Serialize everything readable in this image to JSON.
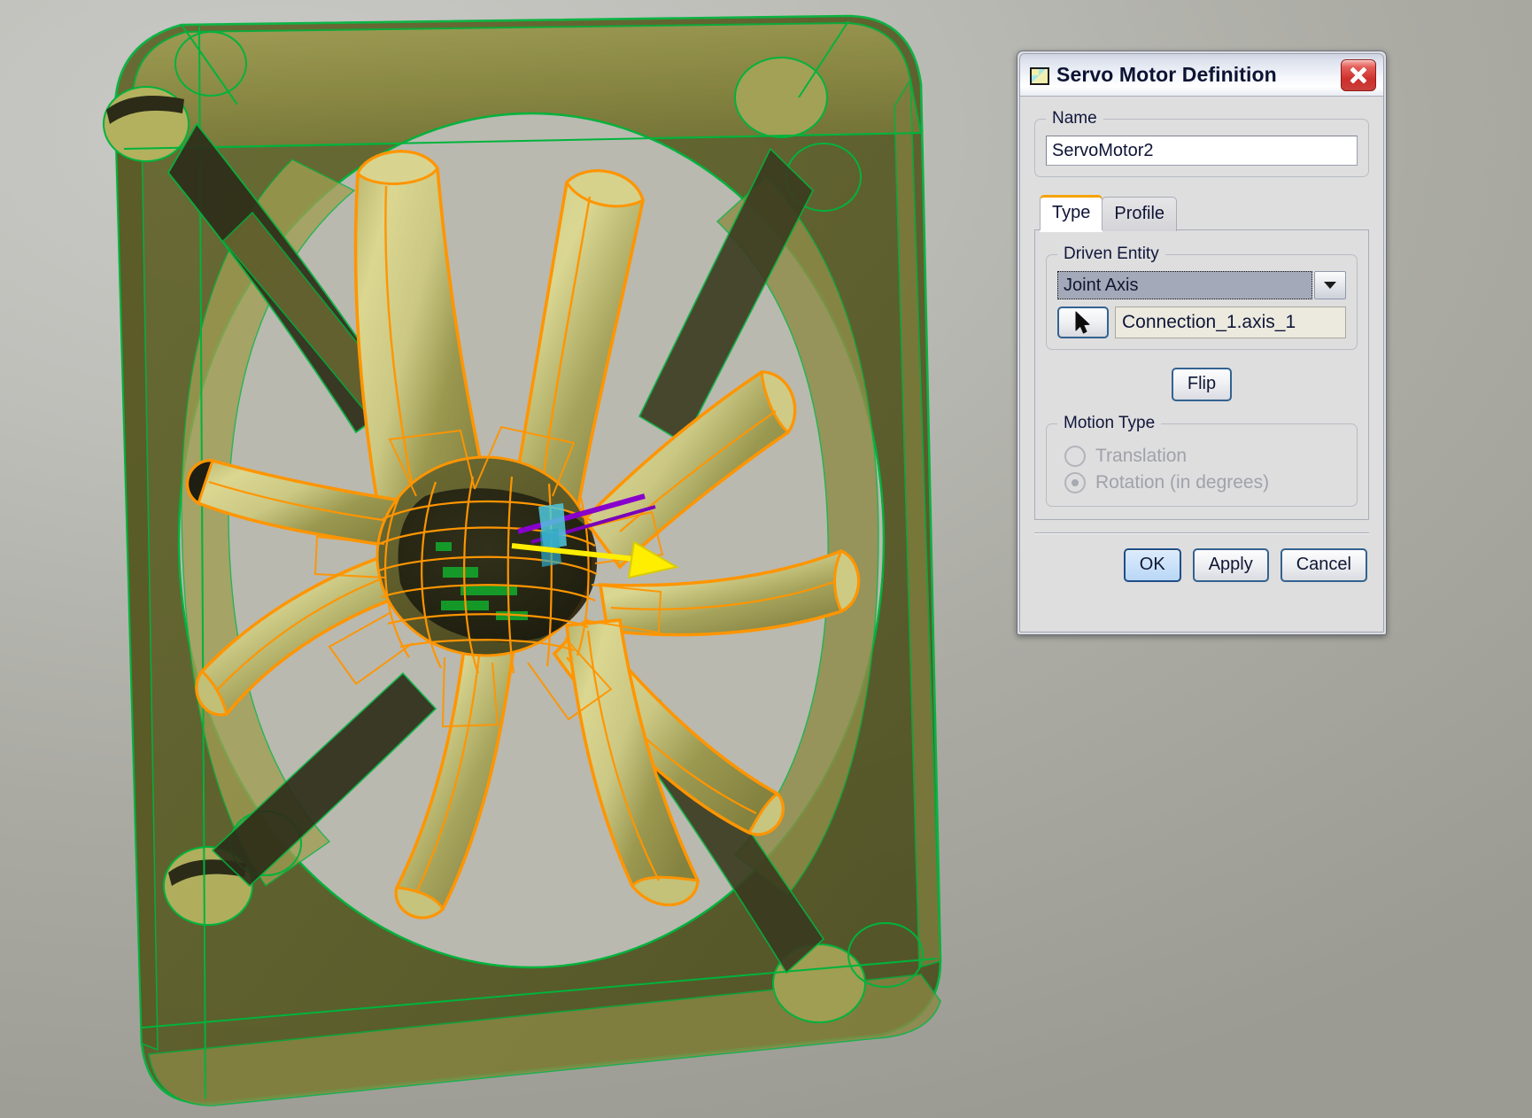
{
  "viewport": {
    "name": "cad-3d-viewport",
    "model_description": "Axial cooling fan assembly shown in shaded-with-edges mode; fan blades highlighted in orange (selected), housing frame edges in green, joint axis manipulator drawn at the hub",
    "colors": {
      "background_top": "#c9c9c6",
      "background_bottom": "#9b9b93",
      "frame_surface": "#5d5f28",
      "frame_surface_light": "#9c9a4f",
      "blade_surface": "#cdca82",
      "blade_surface_dark": "#8a8845",
      "edge_green": "#00b33c",
      "edge_orange": "#ff9500",
      "axis_yellow": "#ffee00",
      "axis_purple": "#8800cc",
      "axis_cyan": "#33c2d6",
      "hub_green": "#14a02a",
      "cavity_black": "#1a1a10"
    },
    "blade_count": 9
  },
  "dialog": {
    "title": "Servo Motor Definition",
    "title_icon": "document-icon",
    "close_icon": "close-icon",
    "name_group": {
      "legend": "Name",
      "value": "ServoMotor2",
      "placeholder": ""
    },
    "tabs": [
      {
        "label": "Type",
        "active": true
      },
      {
        "label": "Profile",
        "active": false
      }
    ],
    "driven_entity": {
      "legend": "Driven Entity",
      "combo_value": "Joint Axis",
      "combo_options": [
        "Joint Axis"
      ],
      "picker_icon": "mouse-pointer-icon",
      "entity_value": "Connection_1.axis_1"
    },
    "flip_button": "Flip",
    "motion_type": {
      "legend": "Motion Type",
      "options": [
        {
          "label": "Translation",
          "checked": false,
          "disabled": true
        },
        {
          "label": "Rotation (in degrees)",
          "checked": true,
          "disabled": true
        }
      ]
    },
    "buttons": {
      "ok": "OK",
      "apply": "Apply",
      "cancel": "Cancel"
    }
  }
}
